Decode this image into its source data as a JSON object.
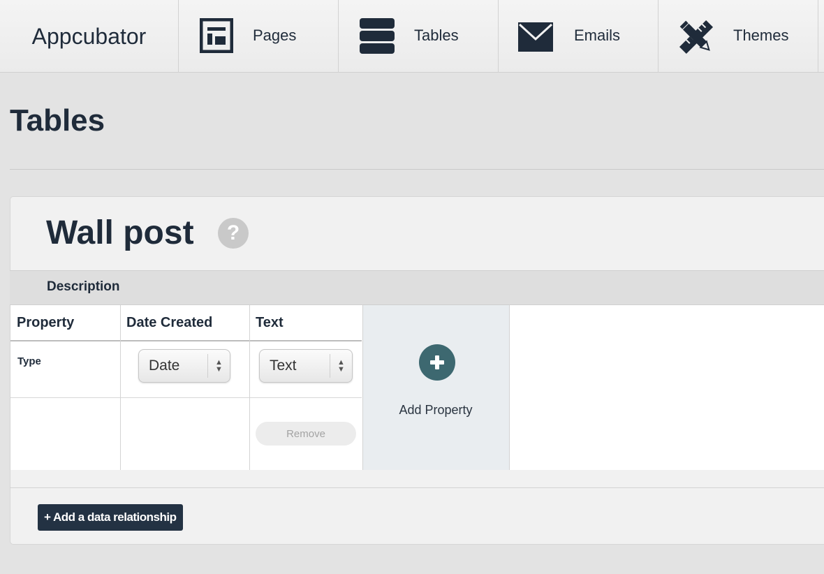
{
  "nav": {
    "brand": "Appcubator",
    "tabs": [
      {
        "label": "Pages",
        "icon": "pages-icon"
      },
      {
        "label": "Tables",
        "icon": "tables-icon"
      },
      {
        "label": "Emails",
        "icon": "envelope-icon"
      },
      {
        "label": "Themes",
        "icon": "pencil-ruler-icon"
      }
    ]
  },
  "page": {
    "title": "Tables"
  },
  "table": {
    "name": "Wall post",
    "help_icon": "?",
    "description_label": "Description",
    "columns": [
      {
        "header": "Property"
      },
      {
        "header": "Date Created",
        "type_value": "Date"
      },
      {
        "header": "Text",
        "type_value": "Text",
        "remove_label": "Remove"
      }
    ],
    "row_label": "Type",
    "add_property_label": "Add Property",
    "add_relationship_label": "+ Add a data relationship"
  },
  "colors": {
    "dark_navy": "#1f2b3a",
    "teal": "#3d6870",
    "button_dark": "#233243"
  }
}
